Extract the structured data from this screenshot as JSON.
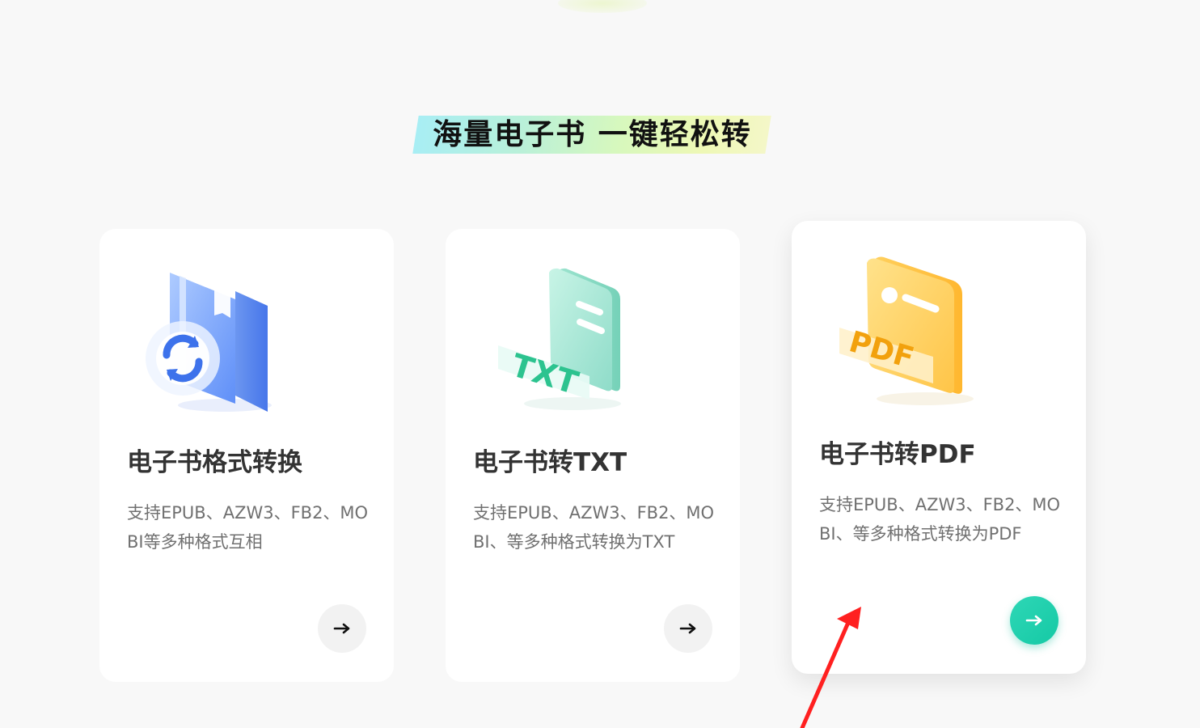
{
  "page": {
    "background_color": "#f8f8f8",
    "section_title": "海量电子书 一键轻松转"
  },
  "cards": [
    {
      "icon": "ebook-format-convert-icon",
      "title": "电子书格式转换",
      "description": "支持EPUB、AZW3、FB2、MOBI等多种格式互相",
      "button_icon": "arrow-right-icon"
    },
    {
      "icon": "txt-document-icon",
      "title": "电子书转TXT",
      "description": "支持EPUB、AZW3、FB2、MOBI、等多种格式转换为TXT",
      "button_icon": "arrow-right-icon"
    },
    {
      "icon": "pdf-document-icon",
      "title": "电子书转PDF",
      "description": "支持EPUB、AZW3、FB2、MOBI、等多种格式转换为PDF",
      "button_icon": "arrow-right-icon",
      "highlighted": true
    }
  ],
  "colors": {
    "accent_green": "#1ccba8",
    "card_text": "#333333",
    "muted_text": "#707070",
    "annotation_red": "#ff2020"
  },
  "icons": {
    "title_highlight": "gradient-highlight",
    "annotation": "red-pointer-arrow"
  }
}
